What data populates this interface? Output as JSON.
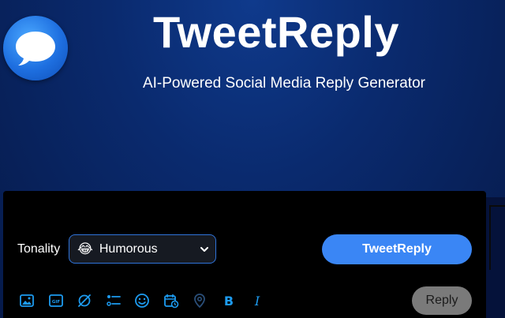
{
  "header": {
    "title": "TweetReply",
    "subtitle": "AI-Powered Social Media Reply Generator",
    "logo_icon": "chat-bubble-icon"
  },
  "composer": {
    "tonality_label": "Tonality",
    "tonality_emoji": "😂",
    "tonality_value": "Humorous",
    "generate_button": "TweetReply",
    "reply_button": "Reply",
    "toolbar_icons": [
      "image-icon",
      "gif-icon",
      "grok-icon",
      "poll-icon",
      "emoji-icon",
      "schedule-icon",
      "location-icon",
      "bold-icon",
      "italic-icon"
    ],
    "gif_text": "GIF",
    "bold_text": "B",
    "italic_text": "I"
  },
  "colors": {
    "accent": "#3a86f5",
    "icon_blue": "#1d9bf0",
    "panel_bg": "#000000",
    "disabled_button": "#7a7a7a"
  }
}
